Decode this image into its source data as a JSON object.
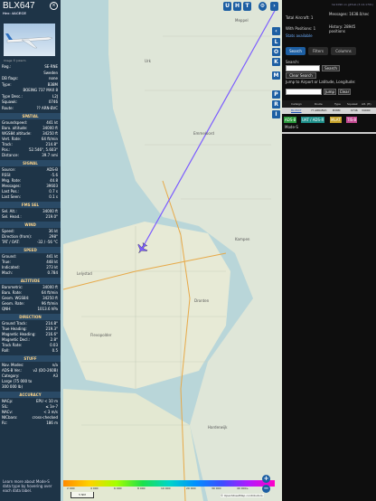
{
  "aircraft": {
    "callsign": "BLX647",
    "hex_line": "Hex: 4ACECE",
    "photo_credit": "Image © Jokerm"
  },
  "info": [
    {
      "k": "Reg.:",
      "v": "SE-RNE"
    },
    {
      "k": "",
      "v": "Sweden"
    },
    {
      "k": "DB flags:",
      "v": "none"
    },
    {
      "k": "Type:",
      "v": "B38M"
    },
    {
      "k": "",
      "v": "BOEING 737 MAX 8"
    },
    {
      "k": "Type Desc.:",
      "v": "L2J"
    },
    {
      "k": "Squawk:",
      "v": "0746"
    },
    {
      "k": "Route:",
      "v": "?? ARN-BVC"
    }
  ],
  "sections": {
    "spatial": {
      "title": "SPATIAL",
      "rows": [
        {
          "k": "Groundspeed:",
          "v": "441 kt"
        },
        {
          "k": "Baro. altitude:",
          "v": "34000 ft"
        },
        {
          "k": "WGS84 altitude:",
          "v": "34250 ft"
        },
        {
          "k": "Vert. Rate:",
          "v": "64 ft/min"
        },
        {
          "k": "Track:",
          "v": "214.8°"
        },
        {
          "k": "Pos.:",
          "v": "52.546°, 5.603°"
        },
        {
          "k": "Distance:",
          "v": "39.7 nmi"
        }
      ]
    },
    "signal": {
      "title": "SIGNAL",
      "rows": [
        {
          "k": "Source:",
          "v": "ADS-B"
        },
        {
          "k": "RSSI:",
          "v": "-5.6"
        },
        {
          "k": "Msg. Rate:",
          "v": "44.8"
        },
        {
          "k": "Messages:",
          "v": "39603"
        },
        {
          "k": "Last Pos.:",
          "v": "0.7 s"
        },
        {
          "k": "Last Seen:",
          "v": "0.1 s"
        }
      ]
    },
    "fms": {
      "title": "FMS SEL",
      "rows": [
        {
          "k": "Sel. Alt.:",
          "v": "34000 ft"
        },
        {
          "k": "Sel. Head.:",
          "v": "219.0°"
        }
      ]
    },
    "wind": {
      "title": "WIND",
      "rows": [
        {
          "k": "Speed:",
          "v": "36 kt"
        },
        {
          "k": "Direction (from):",
          "v": "298°"
        },
        {
          "k": "TAT / OAT:",
          "v": "-32 / -56 °C"
        }
      ]
    },
    "speed": {
      "title": "SPEED",
      "rows": [
        {
          "k": "Ground:",
          "v": "441 kt"
        },
        {
          "k": "True:",
          "v": "448 kt"
        },
        {
          "k": "Indicated:",
          "v": "273 kt"
        },
        {
          "k": "Mach:",
          "v": "0.784"
        }
      ]
    },
    "altitude": {
      "title": "ALTITUDE",
      "rows": [
        {
          "k": "Barometric:",
          "v": "34000 ft"
        },
        {
          "k": "Baro. Rate:",
          "v": "64 ft/min"
        },
        {
          "k": "Geom. WGS84:",
          "v": "34250 ft"
        },
        {
          "k": "Geom. Rate:",
          "v": "96 ft/min"
        },
        {
          "k": "QNH:",
          "v": "1013.6 hPa"
        }
      ]
    },
    "direction": {
      "title": "DIRECTION",
      "rows": [
        {
          "k": "Ground Track:",
          "v": "214.8°"
        },
        {
          "k": "True Heading:",
          "v": "219.3°"
        },
        {
          "k": "Magnetic Heading:",
          "v": "216.6°"
        },
        {
          "k": "Magnetic Decl.:",
          "v": "2.8°"
        },
        {
          "k": "Track Rate:",
          "v": "0.03"
        },
        {
          "k": "Roll:",
          "v": "0.5"
        }
      ]
    },
    "stuff": {
      "title": "STUFF",
      "rows": [
        {
          "k": "Nav. Modes:",
          "v": "n/a"
        },
        {
          "k": "ADS-B Ver.:",
          "v": "v2 (DO-260B)"
        },
        {
          "k": "Category:",
          "v": "A3"
        },
        {
          "k": "Large (75 000 to",
          "v": ""
        },
        {
          "k": "300 000 lb)",
          "v": ""
        }
      ]
    },
    "accuracy": {
      "title": "ACCURACY",
      "rows": [
        {
          "k": "NACp:",
          "v": "EPU < 10 m"
        },
        {
          "k": "SIL:",
          "v": "≤ 1e-7"
        },
        {
          "k": "NACv:",
          "v": "< 3 m/s"
        },
        {
          "k": "NICbaro:",
          "v": "cross-checked"
        },
        {
          "k": "Rc:",
          "v": "186 m"
        }
      ]
    }
  },
  "footnote": "Learn more about Mode-S data type by hovering over each data label.",
  "top_buttons": [
    "U",
    "H",
    "T"
  ],
  "side_buttons": [
    "L",
    "O",
    "K",
    "M",
    "P",
    "R",
    "I"
  ],
  "right": {
    "top_note": "tar1090 on github (3.14.1701)",
    "total_aircraft": "Total Aircraft: 1",
    "with_positions": "With Positions: 1",
    "stats_available": "Stats available",
    "messages": "Messages: 1638.0/sec",
    "history": "History: 28945 positions",
    "tabs": [
      "Search",
      "Filters",
      "Columns"
    ],
    "search_label": "Search:",
    "search_button": "Search",
    "clear_search": "Clear Search",
    "jump_label": "Jump to Airport or Latitude, Longitude:",
    "jump_button": "Jump",
    "clear_button": "Clear",
    "table_headers": [
      "Callsign",
      "Route",
      "Type",
      "Squawk",
      "Alt. (ft)"
    ],
    "table_row": [
      "BLX647",
      "?? ARN-BVC",
      "B38M",
      "0746",
      "34000"
    ],
    "badges": [
      "ADS-B",
      "UAT / ADS-R",
      "MLAT",
      "TIS-B"
    ],
    "mode_s": "Mode-S"
  },
  "map": {
    "places": [
      "Urk",
      "Emmeloord",
      "Lemmer",
      "Lelystad",
      "Dronten",
      "Flevopolder",
      "Kampen",
      "Harderwijk",
      "Meppel"
    ],
    "scale": "5 NM",
    "attribution": "© OpenStreetMap contributors.",
    "legend_ticks": [
      "2 000",
      "4 000",
      "6 000",
      "8 000",
      "10 000",
      "20 000",
      "30 000",
      "40 000+"
    ]
  }
}
